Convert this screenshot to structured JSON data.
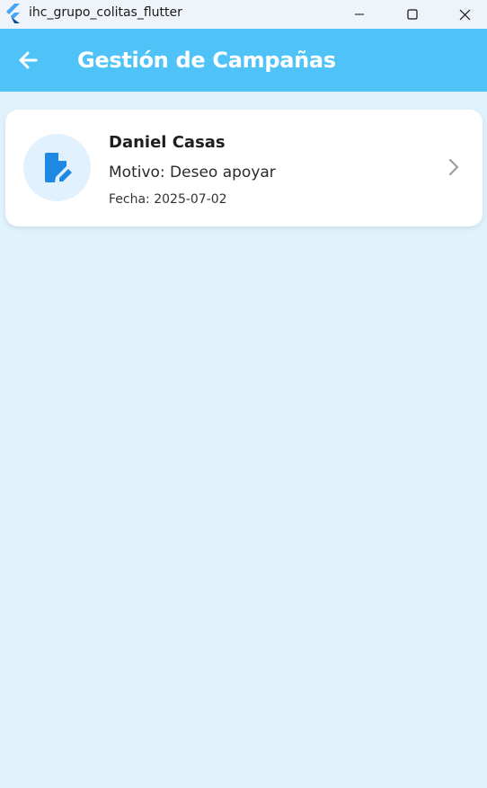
{
  "window": {
    "title": "ihc_grupo_colitas_flutter",
    "icons": [
      "flutter-logo",
      "minimize-icon",
      "maximize-icon",
      "close-icon"
    ]
  },
  "appbar": {
    "title": "Gestión de Campañas",
    "back_icon": "arrow-back-icon"
  },
  "card": {
    "name": "Daniel Casas",
    "motivo": "Motivo: Deseo apoyar",
    "fecha": "Fecha: 2025-07-02",
    "icon": "document-edit-icon",
    "trailing_icon": "chevron-right-icon"
  },
  "colors": {
    "appbar": "#4fc3f7",
    "background": "#e0f3fd",
    "accent": "#1e88e5",
    "avatar_bg": "#e1f1fd"
  }
}
